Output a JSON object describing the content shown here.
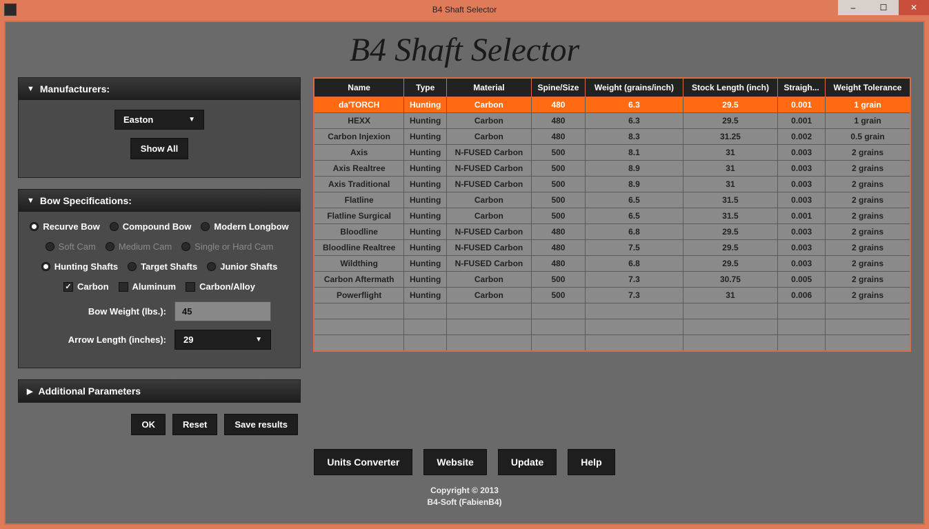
{
  "window": {
    "title": "B4 Shaft Selector"
  },
  "appTitle": "B4 Shaft Selector",
  "panels": {
    "manufacturers": {
      "title": "Manufacturers:",
      "selected": "Easton",
      "showAll": "Show All"
    },
    "bowSpec": {
      "title": "Bow Specifications:",
      "bowTypes": [
        "Recurve Bow",
        "Compound Bow",
        "Modern Longbow"
      ],
      "bowTypeSelected": 0,
      "cams": [
        "Soft Cam",
        "Medium Cam",
        "Single or Hard Cam"
      ],
      "shaftTypes": [
        "Hunting Shafts",
        "Target Shafts",
        "Junior Shafts"
      ],
      "shaftTypeSelected": 0,
      "materials": [
        "Carbon",
        "Aluminum",
        "Carbon/Alloy"
      ],
      "materialSelected": [
        true,
        false,
        false
      ],
      "bowWeightLabel": "Bow Weight (lbs.):",
      "bowWeight": "45",
      "arrowLengthLabel": "Arrow Length (inches):",
      "arrowLength": "29"
    },
    "additional": {
      "title": "Additional Parameters"
    }
  },
  "actions": {
    "ok": "OK",
    "reset": "Reset",
    "save": "Save results"
  },
  "table": {
    "headers": [
      "Name",
      "Type",
      "Material",
      "Spine/Size",
      "Weight (grains/inch)",
      "Stock Length (inch)",
      "Straigh...",
      "Weight Tolerance"
    ],
    "rows": [
      [
        "da'TORCH",
        "Hunting",
        "Carbon",
        "480",
        "6.3",
        "29.5",
        "0.001",
        "1 grain"
      ],
      [
        "HEXX",
        "Hunting",
        "Carbon",
        "480",
        "6.3",
        "29.5",
        "0.001",
        "1 grain"
      ],
      [
        "Carbon Injexion",
        "Hunting",
        "Carbon",
        "480",
        "8.3",
        "31.25",
        "0.002",
        "0.5 grain"
      ],
      [
        "Axis",
        "Hunting",
        "N-FUSED Carbon",
        "500",
        "8.1",
        "31",
        "0.003",
        "2 grains"
      ],
      [
        "Axis Realtree",
        "Hunting",
        "N-FUSED Carbon",
        "500",
        "8.9",
        "31",
        "0.003",
        "2 grains"
      ],
      [
        "Axis Traditional",
        "Hunting",
        "N-FUSED Carbon",
        "500",
        "8.9",
        "31",
        "0.003",
        "2 grains"
      ],
      [
        "Flatline",
        "Hunting",
        "Carbon",
        "500",
        "6.5",
        "31.5",
        "0.003",
        "2 grains"
      ],
      [
        "Flatline Surgical",
        "Hunting",
        "Carbon",
        "500",
        "6.5",
        "31.5",
        "0.001",
        "2 grains"
      ],
      [
        "Bloodline",
        "Hunting",
        "N-FUSED Carbon",
        "480",
        "6.8",
        "29.5",
        "0.003",
        "2 grains"
      ],
      [
        "Bloodline Realtree",
        "Hunting",
        "N-FUSED Carbon",
        "480",
        "7.5",
        "29.5",
        "0.003",
        "2 grains"
      ],
      [
        "Wildthing",
        "Hunting",
        "N-FUSED Carbon",
        "480",
        "6.8",
        "29.5",
        "0.003",
        "2 grains"
      ],
      [
        "Carbon Aftermath",
        "Hunting",
        "Carbon",
        "500",
        "7.3",
        "30.75",
        "0.005",
        "2 grains"
      ],
      [
        "Powerflight",
        "Hunting",
        "Carbon",
        "500",
        "7.3",
        "31",
        "0.006",
        "2 grains"
      ]
    ],
    "emptyRows": 3,
    "selectedRow": 0
  },
  "footer": {
    "buttons": [
      "Units Converter",
      "Website",
      "Update",
      "Help"
    ],
    "copyright1": "Copyright © 2013",
    "copyright2": "B4-Soft (FabienB4)"
  }
}
